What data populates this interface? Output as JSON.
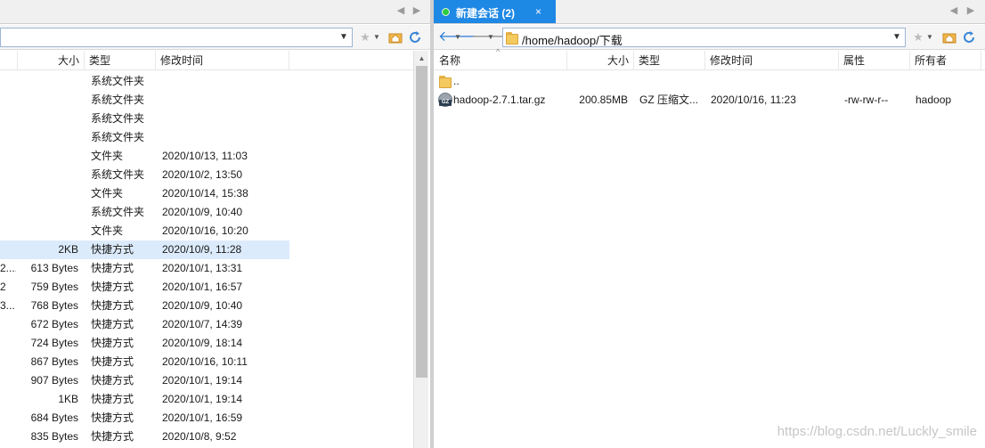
{
  "left": {
    "address": "",
    "columns": {
      "size": "大小",
      "type": "类型",
      "modified": "修改时间"
    },
    "rows": [
      {
        "name": "",
        "size": "",
        "type": "系统文件夹",
        "modified": ""
      },
      {
        "name": "",
        "size": "",
        "type": "系统文件夹",
        "modified": ""
      },
      {
        "name": "",
        "size": "",
        "type": "系统文件夹",
        "modified": ""
      },
      {
        "name": "",
        "size": "",
        "type": "系统文件夹",
        "modified": ""
      },
      {
        "name": "",
        "size": "",
        "type": "文件夹",
        "modified": "2020/10/13, 11:03"
      },
      {
        "name": "",
        "size": "",
        "type": "系统文件夹",
        "modified": "2020/10/2, 13:50"
      },
      {
        "name": "",
        "size": "",
        "type": "文件夹",
        "modified": "2020/10/14, 15:38"
      },
      {
        "name": "",
        "size": "",
        "type": "系统文件夹",
        "modified": "2020/10/9, 10:40"
      },
      {
        "name": "",
        "size": "",
        "type": "文件夹",
        "modified": "2020/10/16, 10:20"
      },
      {
        "name": "",
        "size": "2KB",
        "type": "快捷方式",
        "modified": "2020/10/9, 11:28",
        "selected": true
      },
      {
        "name": "2....",
        "size": "613 Bytes",
        "type": "快捷方式",
        "modified": "2020/10/1, 13:31"
      },
      {
        "name": "2",
        "size": "759 Bytes",
        "type": "快捷方式",
        "modified": "2020/10/1, 16:57"
      },
      {
        "name": "3...",
        "size": "768 Bytes",
        "type": "快捷方式",
        "modified": "2020/10/9, 10:40"
      },
      {
        "name": "",
        "size": "672 Bytes",
        "type": "快捷方式",
        "modified": "2020/10/7, 14:39"
      },
      {
        "name": "",
        "size": "724 Bytes",
        "type": "快捷方式",
        "modified": "2020/10/9, 18:14"
      },
      {
        "name": "",
        "size": "867 Bytes",
        "type": "快捷方式",
        "modified": "2020/10/16, 10:11"
      },
      {
        "name": "",
        "size": "907 Bytes",
        "type": "快捷方式",
        "modified": "2020/10/1, 19:14"
      },
      {
        "name": "",
        "size": "1KB",
        "type": "快捷方式",
        "modified": "2020/10/1, 19:14"
      },
      {
        "name": "",
        "size": "684 Bytes",
        "type": "快捷方式",
        "modified": "2020/10/1, 16:59"
      },
      {
        "name": "",
        "size": "835 Bytes",
        "type": "快捷方式",
        "modified": "2020/10/8, 9:52"
      }
    ]
  },
  "right": {
    "session_tab": "新建会话 (2)",
    "session_close": "×",
    "address": "/home/hadoop/下载",
    "columns": {
      "name": "名称",
      "size": "大小",
      "type": "类型",
      "modified": "修改时间",
      "perms": "属性",
      "owner": "所有者"
    },
    "rows": [
      {
        "icon": "folder",
        "name": "..",
        "size": "",
        "type": "",
        "modified": "",
        "perms": "",
        "owner": ""
      },
      {
        "icon": "archive",
        "name": "hadoop-2.7.1.tar.gz",
        "size": "200.85MB",
        "type": "GZ 压缩文...",
        "modified": "2020/10/16, 11:23",
        "perms": "-rw-rw-r--",
        "owner": "hadoop"
      }
    ]
  },
  "archive_badge": "GZ",
  "watermark": "https://blog.csdn.net/Luckly_smile",
  "colors": {
    "session_tab": "#1e88e5",
    "selected_row": "#dcebfb",
    "status_connected": "#2ecc40",
    "folder": "#f4c95d"
  }
}
